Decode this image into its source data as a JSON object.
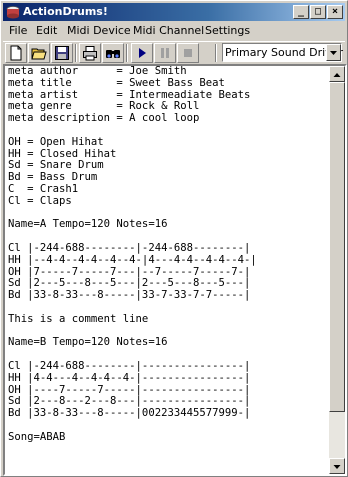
{
  "window": {
    "title": "ActionDrums!",
    "controls": {
      "minimize": "_",
      "maximize": "□",
      "close": "×"
    }
  },
  "menu": [
    "File",
    "Edit",
    "Midi Device",
    "Midi Channel",
    "Settings"
  ],
  "toolbar": {
    "icons": [
      "new-file-icon",
      "open-folder-icon",
      "save-icon",
      "print-icon",
      "find-icon",
      "play-icon",
      "pause-icon",
      "stop-icon"
    ],
    "driver_select": {
      "value": "Primary Sound Driver"
    }
  },
  "editor": {
    "lines": [
      "meta author      = Joe Smith",
      "meta title       = Sweet Bass Beat",
      "meta artist      = Intermeadiate Beats",
      "meta genre       = Rock & Roll",
      "meta description = A cool loop",
      "",
      "OH = Open Hihat",
      "HH = Closed Hihat",
      "Sd = Snare Drum",
      "Bd = Bass Drum",
      "C  = Crash1",
      "Cl = Claps",
      "",
      "Name=A Tempo=120 Notes=16",
      "",
      "Cl |-244-688--------|-244-688--------|",
      "HH |--4-4--4-4--4--4-|4---4-4--4-4--4-|",
      "OH |7-----7-----7---|--7-----7-----7-|",
      "Sd |2---5---8---5---|2---5---8---5---|",
      "Bd |33-8-33---8-----|33-7-33-7-7-----|",
      "",
      "This is a comment line",
      "",
      "Name=B Tempo=120 Notes=16",
      "",
      "Cl |-244-688--------|----------------|",
      "HH |4-4---4--4-4--4-|----------------|",
      "OH |----7-----7-----|----------------|",
      "Sd |2---8---2---8---|----------------|",
      "Bd |33-8-33---8-----|002233445577999-|",
      "",
      "Song=ABAB"
    ]
  },
  "colors": {
    "titlebar_start": "#0a246a",
    "titlebar_end": "#a6caf0",
    "chrome": "#d4d0c8",
    "play_icon": "#000080"
  }
}
